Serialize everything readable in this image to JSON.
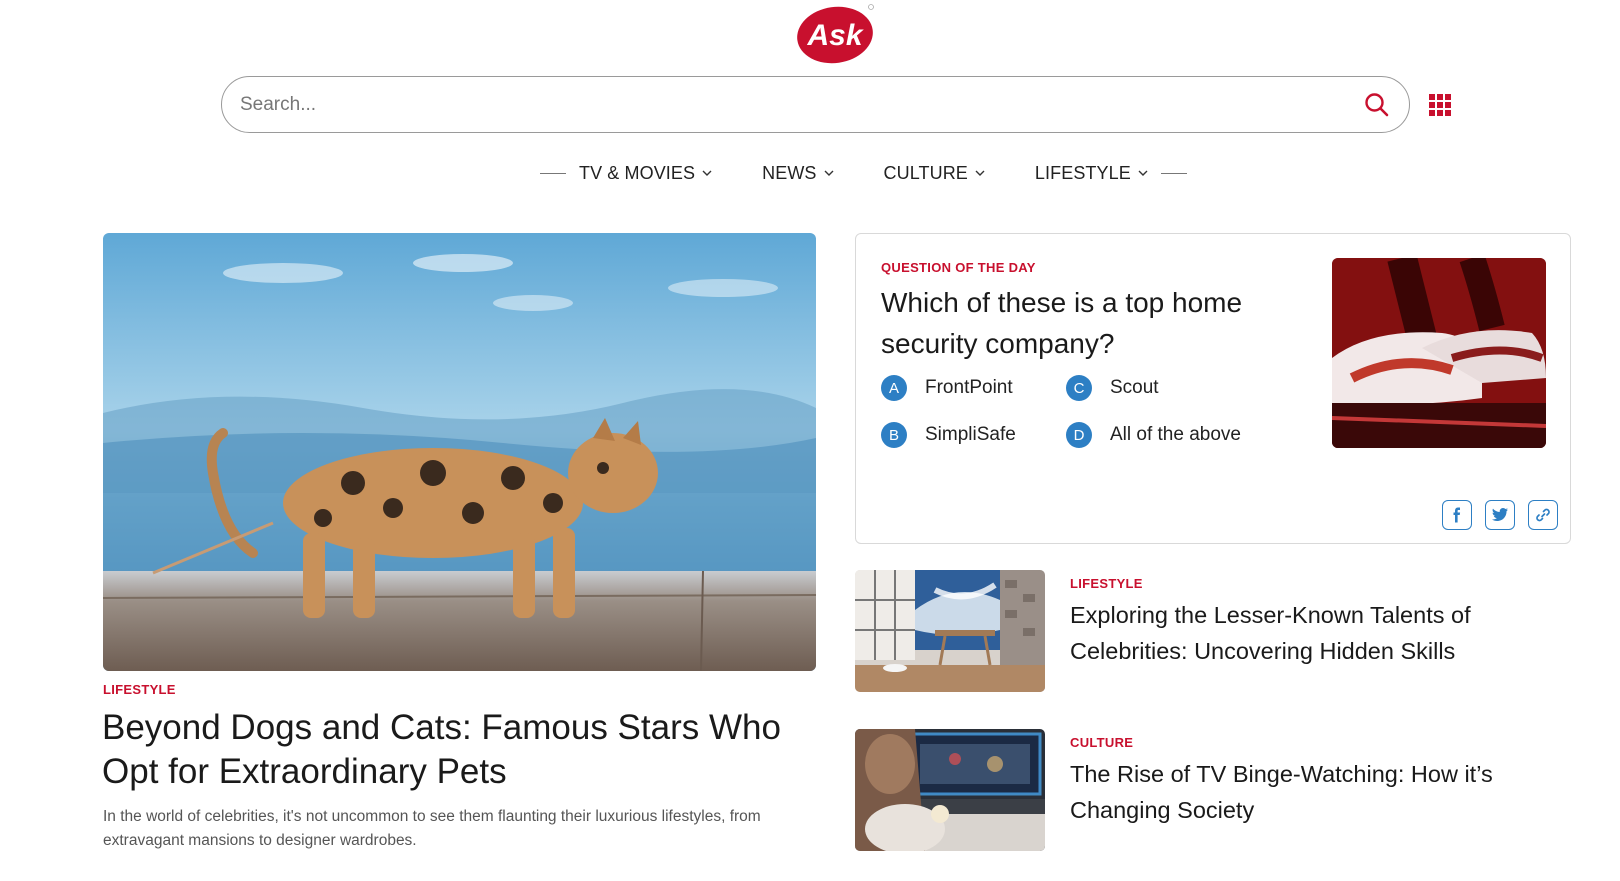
{
  "brand": {
    "logo_text": "Ask",
    "accent": "#c8102e"
  },
  "search": {
    "placeholder": "Search...",
    "value": ""
  },
  "header_icons": [
    "search-icon",
    "apps-grid-icon"
  ],
  "nav": {
    "items": [
      {
        "label": "TV & MOVIES"
      },
      {
        "label": "NEWS"
      },
      {
        "label": "CULTURE"
      },
      {
        "label": "LIFESTYLE"
      }
    ]
  },
  "hero": {
    "category": "LIFESTYLE",
    "title": "Beyond Dogs and Cats: Famous Stars Who Opt for Extraordinary Pets",
    "description": "In the world of celebrities, it's not uncommon to see them flaunting their luxurious lifestyles, from extravagant mansions to designer wardrobes."
  },
  "question": {
    "label": "QUESTION OF THE DAY",
    "text": "Which of these is a top home security company?",
    "answers": [
      {
        "letter": "A",
        "text": "FrontPoint"
      },
      {
        "letter": "B",
        "text": "SimpliSafe"
      },
      {
        "letter": "C",
        "text": "Scout"
      },
      {
        "letter": "D",
        "text": "All of the above"
      }
    ],
    "share_icons": [
      "facebook-icon",
      "twitter-icon",
      "link-icon"
    ],
    "badge_color": "#2d7fc4"
  },
  "side_articles": [
    {
      "category": "LIFESTYLE",
      "title": "Exploring the Lesser-Known Talents of Celebrities: Uncovering Hidden Skills"
    },
    {
      "category": "CULTURE",
      "title": "The Rise of TV Binge-Watching: How it’s Changing Society"
    }
  ]
}
